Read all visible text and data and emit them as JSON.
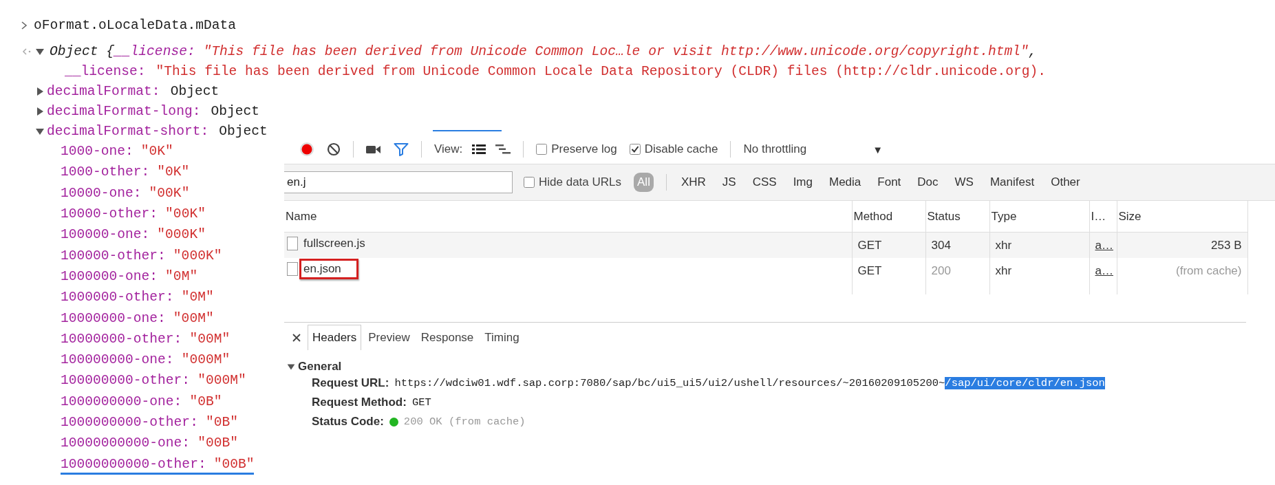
{
  "console": {
    "input": {
      "expression": "oFormat.oLocaleData.mData"
    },
    "result": {
      "expanded": true,
      "summary": {
        "type_label": "Object {",
        "key": "__license:",
        "value": "\"This file has been derived from Unicode Common Loc…le or visit http://www.unicode.org/copyright.html\"",
        "tail": ","
      },
      "properties": [
        {
          "kind": "string",
          "key": "__license:",
          "value": "\"This file has been derived from Unicode Common Locale Data Repository (CLDR) files (http://cldr.unicode.org)."
        },
        {
          "kind": "object",
          "key": "decimalFormat:",
          "value": "Object",
          "expanded": false
        },
        {
          "kind": "object",
          "key": "decimalFormat-long:",
          "value": "Object",
          "expanded": false
        },
        {
          "kind": "object",
          "key": "decimalFormat-short:",
          "value": "Object",
          "expanded": true,
          "children": [
            {
              "key": "1000-one:",
              "value": "\"0K\"",
              "selected": false
            },
            {
              "key": "1000-other:",
              "value": "\"0K\"",
              "selected": false
            },
            {
              "key": "10000-one:",
              "value": "\"00K\"",
              "selected": false
            },
            {
              "key": "10000-other:",
              "value": "\"00K\"",
              "selected": false
            },
            {
              "key": "100000-one:",
              "value": "\"000K\"",
              "selected": false
            },
            {
              "key": "100000-other:",
              "value": "\"000K\"",
              "selected": false
            },
            {
              "key": "1000000-one:",
              "value": "\"0M\"",
              "selected": false
            },
            {
              "key": "1000000-other:",
              "value": "\"0M\"",
              "selected": false
            },
            {
              "key": "10000000-one:",
              "value": "\"00M\"",
              "selected": false
            },
            {
              "key": "10000000-other:",
              "value": "\"00M\"",
              "selected": false
            },
            {
              "key": "100000000-one:",
              "value": "\"000M\"",
              "selected": false
            },
            {
              "key": "100000000-other:",
              "value": "\"000M\"",
              "selected": false
            },
            {
              "key": "1000000000-one:",
              "value": "\"0B\"",
              "selected": false
            },
            {
              "key": "1000000000-other:",
              "value": "\"0B\"",
              "selected": false
            },
            {
              "key": "10000000000-one:",
              "value": "\"00B\"",
              "selected": false
            },
            {
              "key": "10000000000-other:",
              "value": "\"00B\"",
              "selected": true
            }
          ]
        }
      ]
    }
  },
  "network": {
    "toolbar": {
      "recording": true,
      "filter_on": true,
      "view_label": "View:",
      "view_modes": [
        {
          "kind": "list",
          "selected": true
        },
        {
          "kind": "waterfall",
          "selected": false
        }
      ],
      "checkboxes": [
        {
          "label": "Preserve log",
          "checked": false
        },
        {
          "label": "Disable cache",
          "checked": true
        }
      ],
      "throttling": {
        "value": "No throttling",
        "caret": "▼"
      }
    },
    "filter_bar": {
      "filter": {
        "value": "en.j"
      },
      "hide_data_urls": {
        "label": "Hide data URLs",
        "checked": false
      },
      "types": [
        {
          "label": "All",
          "selected": true
        },
        {
          "label": "XHR",
          "selected": false
        },
        {
          "label": "JS",
          "selected": false
        },
        {
          "label": "CSS",
          "selected": false
        },
        {
          "label": "Img",
          "selected": false
        },
        {
          "label": "Media",
          "selected": false
        },
        {
          "label": "Font",
          "selected": false
        },
        {
          "label": "Doc",
          "selected": false
        },
        {
          "label": "WS",
          "selected": false
        },
        {
          "label": "Manifest",
          "selected": false
        },
        {
          "label": "Other",
          "selected": false
        }
      ]
    },
    "table": {
      "columns": [
        "Name",
        "Method",
        "Status",
        "Type",
        "I…",
        "Size"
      ],
      "rows": [
        {
          "name": "fullscreen.js",
          "method": "GET",
          "status": "304",
          "type": "xhr",
          "initiator": "a…",
          "size": "253 B",
          "cached": false,
          "highlighted": false
        },
        {
          "name": "en.json",
          "method": "GET",
          "status": "200",
          "type": "xhr",
          "initiator": "a…",
          "size": "(from cache)",
          "cached": true,
          "highlighted": true
        }
      ]
    },
    "details": {
      "tabs": [
        {
          "label": "Headers",
          "selected": true
        },
        {
          "label": "Preview",
          "selected": false
        },
        {
          "label": "Response",
          "selected": false
        },
        {
          "label": "Timing",
          "selected": false
        }
      ],
      "section": {
        "title": "General",
        "expanded": true,
        "fields": [
          {
            "kind": "url",
            "label": "Request URL:",
            "parts": [
              {
                "text": "https://wdciw01.wdf.sap.corp:7080/sap/bc/ui5_ui5/ui2/ushell/resources/~20160209105200~",
                "selected": false
              },
              {
                "text": "/sap/ui/core/cldr/en.json",
                "selected": true
              }
            ]
          },
          {
            "kind": "text",
            "label": "Request Method:",
            "value": "GET"
          },
          {
            "kind": "status",
            "label": "Status Code:",
            "value": "200 OK (from cache)",
            "color": "#22b522"
          }
        ]
      }
    }
  }
}
